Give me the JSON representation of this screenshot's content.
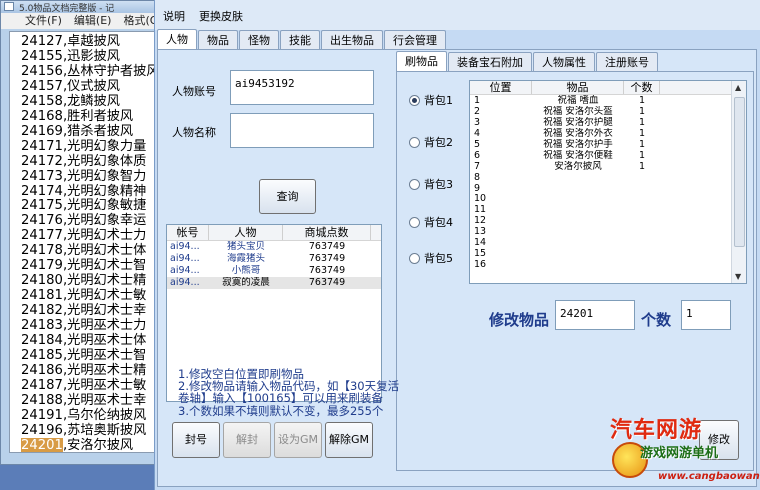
{
  "notepad": {
    "title": "5.0物品文档完整版 - 记",
    "menu": [
      "文件(F)",
      "编辑(E)",
      "格式(O"
    ],
    "lines": [
      "24127,卓越披风",
      "24155,迅影披风",
      "24156,丛林守护者披风",
      "24157,仪式披风",
      "24158,龙鳞披风",
      "24168,胜利者披风",
      "24169,猎杀者披风",
      "24171,光明幻象力量",
      "24172,光明幻象体质",
      "24173,光明幻象智力",
      "24174,光明幻象精神",
      "24175,光明幻象敏捷",
      "24176,光明幻象幸运",
      "24177,光明幻术士力",
      "24178,光明幻术士体",
      "24179,光明幻术士智",
      "24180,光明幻术士精",
      "24181,光明幻术士敏",
      "24182,光明幻术士幸",
      "24183,光明巫术士力",
      "24184,光明巫术士体",
      "24185,光明巫术士智",
      "24186,光明巫术士精",
      "24187,光明巫术士敏",
      "24188,光明巫术士幸",
      "24191,乌尔伦纳披风",
      "24196,苏培奥斯披风"
    ],
    "last_line_code": "24201",
    "last_line_name": ",安洛尔披风"
  },
  "menubar": {
    "help": "说明",
    "skin": "更换皮肤"
  },
  "tabs": [
    "人物",
    "物品",
    "怪物",
    "技能",
    "出生物品",
    "行会管理"
  ],
  "left": {
    "account_label": "人物账号",
    "account_value": "ai9453192",
    "name_label": "人物名称",
    "name_value": "",
    "query_button": "查询",
    "table": {
      "headers": [
        "帐号",
        "人物",
        "商城点数"
      ],
      "rows": [
        {
          "account": "ai94...",
          "name": "猪头宝贝",
          "points": "763749"
        },
        {
          "account": "ai94...",
          "name": "海霞猪头",
          "points": "763749"
        },
        {
          "account": "ai94...",
          "name": "小熊哥",
          "points": "763749"
        },
        {
          "account": "ai94...",
          "name": "寂寞的凌晨",
          "points": "763749"
        }
      ]
    },
    "buttons": {
      "ban": "封号",
      "unban": "解封",
      "set_gm": "设为GM",
      "remove_gm": "解除GM"
    }
  },
  "right": {
    "tabs": [
      "刷物品",
      "装备宝石附加",
      "人物属性",
      "注册账号"
    ],
    "radios": [
      "背包1",
      "背包2",
      "背包3",
      "背包4",
      "背包5"
    ],
    "item_table": {
      "headers": [
        "位置",
        "物品",
        "个数"
      ],
      "rows": [
        {
          "pos": "1",
          "item": "祝福 嗜血",
          "count": "1"
        },
        {
          "pos": "2",
          "item": "祝福 安洛尔头盔",
          "count": "1"
        },
        {
          "pos": "3",
          "item": "祝福 安洛尔护腿",
          "count": "1"
        },
        {
          "pos": "4",
          "item": "祝福 安洛尔外衣",
          "count": "1"
        },
        {
          "pos": "5",
          "item": "祝福 安洛尔护手",
          "count": "1"
        },
        {
          "pos": "6",
          "item": "祝福 安洛尔便鞋",
          "count": "1"
        },
        {
          "pos": "7",
          "item": "安洛尔披风",
          "count": "1"
        },
        {
          "pos": "8",
          "item": "",
          "count": ""
        },
        {
          "pos": "9",
          "item": "",
          "count": ""
        },
        {
          "pos": "10",
          "item": "",
          "count": ""
        },
        {
          "pos": "11",
          "item": "",
          "count": ""
        },
        {
          "pos": "12",
          "item": "",
          "count": ""
        },
        {
          "pos": "13",
          "item": "",
          "count": ""
        },
        {
          "pos": "14",
          "item": "",
          "count": ""
        },
        {
          "pos": "15",
          "item": "",
          "count": ""
        },
        {
          "pos": "16",
          "item": "",
          "count": ""
        }
      ]
    },
    "modify_item_label": "修改物品",
    "modify_item_value": "24201",
    "count_label": "个数",
    "count_value": "1",
    "notes": [
      "1.修改空白位置即刷物品",
      "2.修改物品请输入物品代码，如【30天复活卷轴】输入【100165】可以用来刷装备",
      "3.个数如果不填则默认不变，最多255个"
    ],
    "modify_button": "修改"
  },
  "watermark": {
    "line1": "汽车网游",
    "line2": "游戏网游单机",
    "line3": "www.cangbaowan.net"
  },
  "colors": {
    "accent_text": "#1f3c8c",
    "highlight": "#d89b45",
    "panel_bg": "#d6e6f8"
  }
}
